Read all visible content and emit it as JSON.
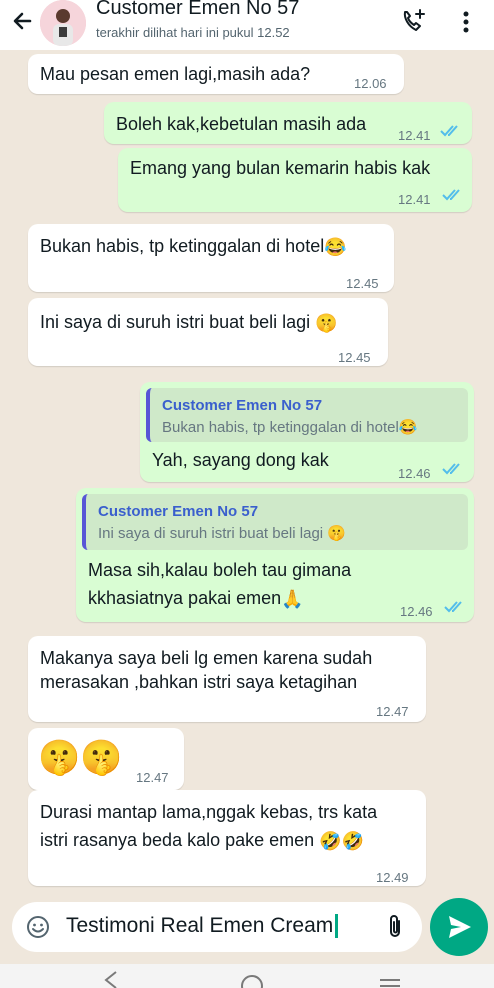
{
  "header": {
    "title": "Customer Emen No 57",
    "subtitle": "terakhir dilihat hari ini pukul 12.52"
  },
  "messages": [
    {
      "text": "Mau pesan emen lagi,masih ada?",
      "time": "12.06"
    },
    {
      "text": "Boleh kak,kebetulan masih ada",
      "time": "12.41"
    },
    {
      "text": "Emang yang bulan kemarin habis kak",
      "time": "12.41"
    },
    {
      "text": "Bukan habis, tp ketinggalan di hotel",
      "emoji": "😂",
      "time": "12.45"
    },
    {
      "text": "Ini saya di suruh istri buat beli lagi",
      "emoji": "🤫",
      "time": "12.45"
    },
    {
      "quote_name": "Customer Emen No 57",
      "quote_text": "Bukan habis, tp ketinggalan di hotel",
      "quote_emoji": "😂",
      "text": "Yah, sayang dong kak",
      "time": "12.46"
    },
    {
      "quote_name": "Customer Emen No 57",
      "quote_text": "Ini saya di suruh istri buat beli lagi",
      "quote_emoji": "🤫",
      "text_line1": "Masa sih,kalau boleh tau gimana",
      "text_line2": "kkhasiatnya pakai emen",
      "emoji": "🙏",
      "time": "12.46"
    },
    {
      "text_line1": "Makanya saya beli lg emen karena sudah",
      "text_line2": "merasakan ,bahkan istri saya ketagihan",
      "time": "12.47"
    },
    {
      "emoji": "🤫🤫",
      "time": "12.47"
    },
    {
      "text_line1": "Durasi mantap lama,nggak kebas, trs kata",
      "text_line2": "istri rasanya beda kalo pake emen",
      "emoji": "🤣🤣",
      "time": "12.49"
    }
  ],
  "input": {
    "value": "Testimoni Real Emen Cream"
  },
  "colors": {
    "accent": "#00a884",
    "out_bubble": "#d9fdd3",
    "in_bubble": "#ffffff",
    "tick_read": "#53bdeb"
  },
  "icons": [
    "back-arrow-icon",
    "add-call-icon",
    "more-vert-icon",
    "smiley-icon",
    "attach-icon",
    "send-icon"
  ]
}
